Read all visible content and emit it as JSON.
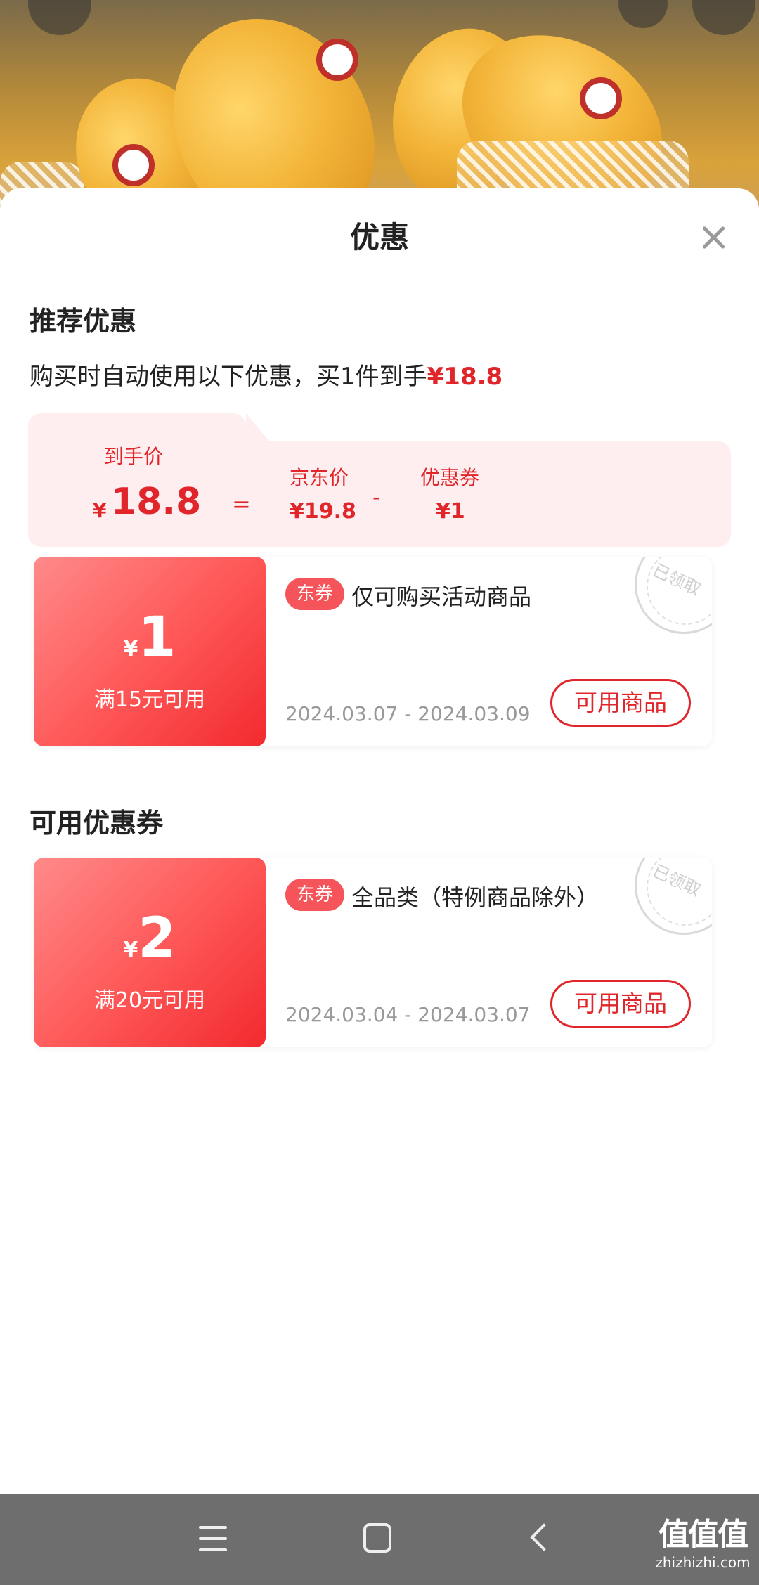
{
  "sheet": {
    "title": "优惠",
    "recommended": {
      "title": "推荐优惠",
      "summary_prefix": "购买时自动使用以下优惠，买1件到手",
      "summary_price": "¥18.8",
      "breakdown": {
        "final_label": "到手价",
        "final_yen": "¥",
        "final_value": "18.8",
        "equals": "=",
        "jd_label": "京东价",
        "jd_value": "¥19.8",
        "minus": "-",
        "coupon_label": "优惠券",
        "coupon_value": "¥1"
      }
    },
    "coupons_title": "可用优惠券"
  },
  "coupons": [
    {
      "yen": "¥",
      "amount": "1",
      "condition": "满15元可用",
      "tag": "东券",
      "description": "仅可购买活动商品",
      "dates": "2024.03.07 - 2024.03.09",
      "button": "可用商品",
      "stamp": "已领取"
    },
    {
      "yen": "¥",
      "amount": "2",
      "condition": "满20元可用",
      "tag": "东券",
      "description": "全品类（特例商品除外）",
      "dates": "2024.03.04 - 2024.03.07",
      "button": "可用商品",
      "stamp": "已领取"
    }
  ],
  "watermark": {
    "main": "值值值",
    "sub": "zhizhizhi.com"
  },
  "colors": {
    "accent_red": "#e0262b",
    "panel_pink": "#ffeeef",
    "navbar_gray": "#6e6e6e"
  }
}
